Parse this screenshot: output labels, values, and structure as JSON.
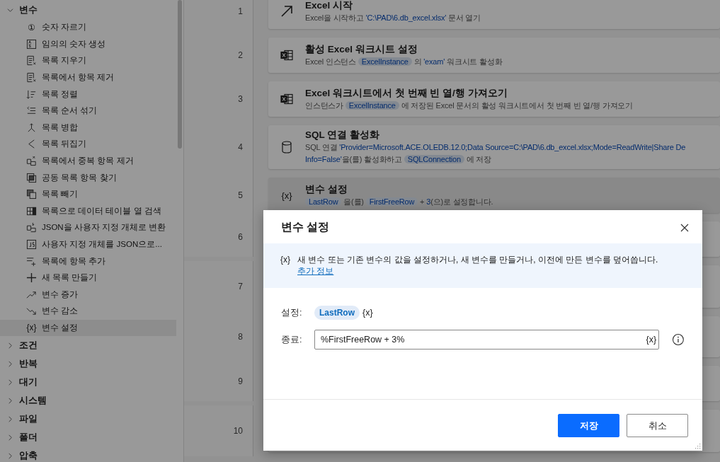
{
  "sidebar": {
    "groups": [
      {
        "label": "변수",
        "expanded": true,
        "children": [
          {
            "label": "숫자 자르기",
            "glyph": "①",
            "selected": false
          },
          {
            "label": "임의의 숫자 생성",
            "selected": false
          },
          {
            "label": "목록 지우기",
            "selected": false
          },
          {
            "label": "목록에서 항목 제거",
            "selected": false
          },
          {
            "label": "목록 정렬",
            "selected": false
          },
          {
            "label": "목록 순서 섞기",
            "selected": false
          },
          {
            "label": "목록 병합",
            "selected": false
          },
          {
            "label": "목록 뒤집기",
            "selected": false
          },
          {
            "label": "목록에서 중복 항목 제거",
            "selected": false
          },
          {
            "label": "공동 목록 항목 찾기",
            "selected": false
          },
          {
            "label": "목록 빼기",
            "selected": false
          },
          {
            "label": "목록으로 데이터 테이블 열 검색",
            "selected": false
          },
          {
            "label": "JSON을 사용자 지정 개체로 변환",
            "selected": false
          },
          {
            "label": "사용자 지정 개체를 JSON으로...",
            "selected": false
          },
          {
            "label": "목록에 항목 추가",
            "selected": false
          },
          {
            "label": "새 목록 만들기",
            "selected": false
          },
          {
            "label": "변수 증가",
            "selected": false
          },
          {
            "label": "변수 감소",
            "selected": false
          },
          {
            "label": "변수 설정",
            "glyph": "{x}",
            "selected": true
          }
        ]
      },
      {
        "label": "조건",
        "expanded": false
      },
      {
        "label": "반복",
        "expanded": false
      },
      {
        "label": "대기",
        "expanded": false
      },
      {
        "label": "시스템",
        "expanded": false
      },
      {
        "label": "파일",
        "expanded": false
      },
      {
        "label": "폴더",
        "expanded": false
      },
      {
        "label": "압축",
        "expanded": false
      }
    ]
  },
  "steps": [
    {
      "number": "1",
      "kind": "arrow",
      "title": "Excel 시작",
      "selected": false,
      "lines": [
        [
          {
            "kind": "text",
            "text": "Excel을 시작하고 "
          },
          {
            "kind": "value",
            "text": "'C:\\PAD\\6.db_excel.xlsx'"
          },
          {
            "kind": "text",
            "text": " 문서 열기"
          }
        ]
      ]
    },
    {
      "number": "2",
      "kind": "excel",
      "title": "활성 Excel 워크시트 설정",
      "selected": false,
      "lines": [
        [
          {
            "kind": "text",
            "text": "Excel 인스턴스 "
          },
          {
            "kind": "chip",
            "text": "ExcelInstance"
          },
          {
            "kind": "text",
            "text": " 의 "
          },
          {
            "kind": "value",
            "text": "'exam'"
          },
          {
            "kind": "text",
            "text": " 워크시트 활성화"
          }
        ]
      ]
    },
    {
      "number": "3",
      "kind": "excel",
      "title": "Excel 워크시트에서 첫 번째 빈 열/행 가져오기",
      "selected": false,
      "lines": [
        [
          {
            "kind": "text",
            "text": "인스턴스가 "
          },
          {
            "kind": "chip",
            "text": "ExcelInstance"
          },
          {
            "kind": "text",
            "text": " 에 저장된 Excel 문서의 활성 워크시트에서 첫 번째 빈 열/행 가져오기"
          }
        ]
      ]
    },
    {
      "number": "4",
      "kind": "database",
      "title": "SQL 연결 활성화",
      "selected": false,
      "lines": [
        [
          {
            "kind": "text",
            "text": "SQL 연결 "
          },
          {
            "kind": "value",
            "text": "'Provider=Microsoft.ACE.OLEDB.12.0;Data Source=C:\\PAD\\6.db_excel.xlsx;Mode=ReadWrite|Share De"
          }
        ],
        [
          {
            "kind": "value",
            "text": "Info=False'"
          },
          {
            "kind": "text",
            "text": "을(를) 활성화하고 "
          },
          {
            "kind": "chip",
            "text": "SQLConnection"
          },
          {
            "kind": "text",
            "text": " 에 저장"
          }
        ]
      ]
    },
    {
      "number": "5",
      "kind": "glyph",
      "glyph": "{x}",
      "title": "변수 설정",
      "selected": true,
      "lines": [
        [
          {
            "kind": "chip",
            "text": "LastRow"
          },
          {
            "kind": "text",
            "text": " 을(를) "
          },
          {
            "kind": "chip",
            "text": "FirstFreeRow"
          },
          {
            "kind": "text",
            "text": " + "
          },
          {
            "kind": "value",
            "text": "3"
          },
          {
            "kind": "text",
            "text": "(으)로 설정합니다."
          }
        ]
      ]
    },
    {
      "number": "6",
      "kind": "hidden"
    },
    {
      "number": "7",
      "kind": "hidden"
    },
    {
      "number": "8",
      "kind": "hidden"
    },
    {
      "number": "9",
      "kind": "hidden"
    },
    {
      "number": "10",
      "kind": "hidden"
    }
  ],
  "dialog": {
    "title": "변수 설정",
    "info": {
      "glyph": "{x}",
      "text": "새 변수 또는 기존 변수의 값을 설정하거나, 새 변수를 만들거나, 이전에 만든 변수를 덮어씁니다.",
      "link": "추가 정보"
    },
    "set_label": "설정:",
    "set_variable": "LastRow",
    "set_glyph": "{x}",
    "to_label": "종료:",
    "to_value": "%FirstFreeRow + 3%",
    "to_glyph": "{x}",
    "buttons": [
      {
        "label": "저장",
        "kind": "primary"
      },
      {
        "label": "취소",
        "kind": "secondary"
      }
    ]
  }
}
